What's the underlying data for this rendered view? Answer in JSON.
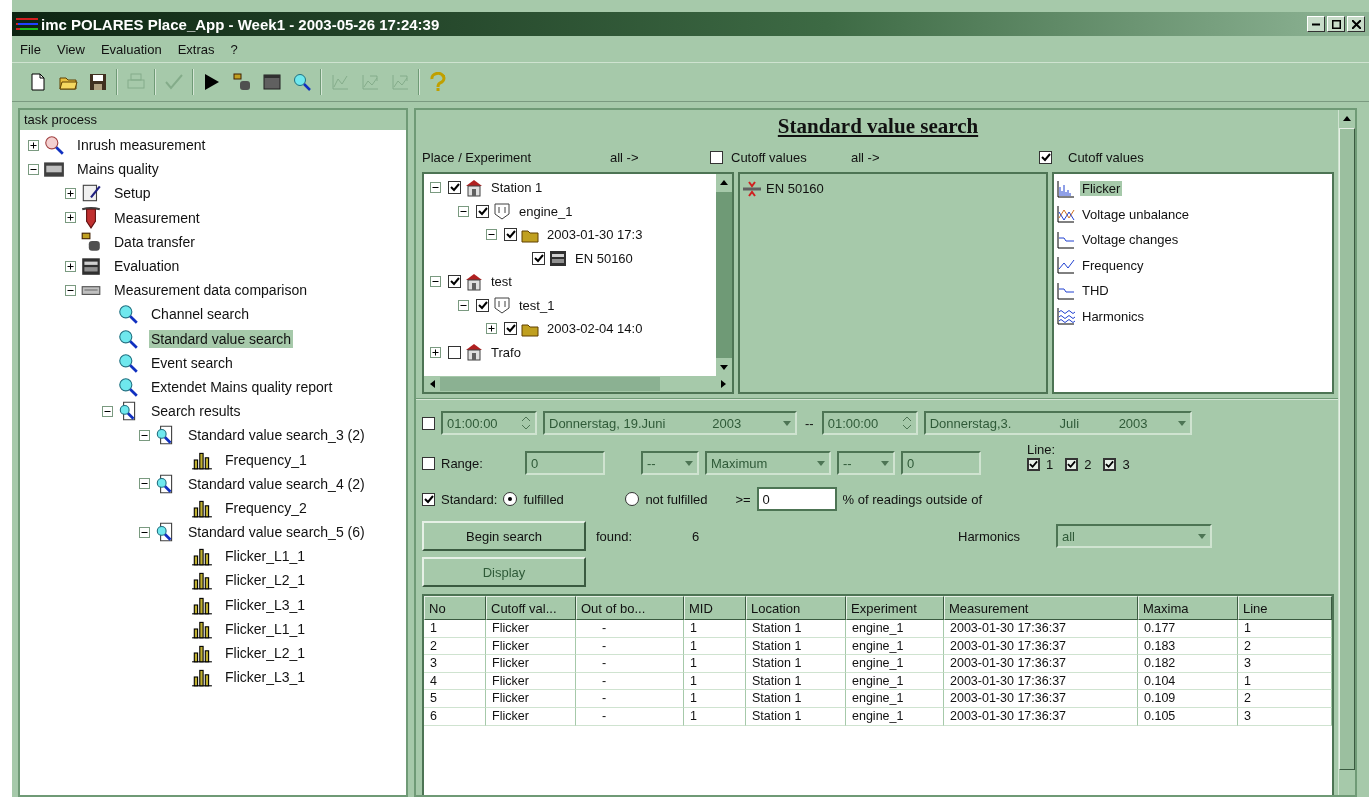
{
  "window": {
    "title": "imc POLARES Place_App - Week1 - 2003-05-26 17:24:39"
  },
  "menu": [
    "File",
    "View",
    "Evaluation",
    "Extras",
    "?"
  ],
  "toolbar": [
    {
      "kind": "new",
      "disabled": false
    },
    {
      "kind": "open",
      "disabled": false
    },
    {
      "kind": "save",
      "disabled": false
    },
    {
      "kind": "sep"
    },
    {
      "kind": "print",
      "disabled": true
    },
    {
      "kind": "sep"
    },
    {
      "kind": "check",
      "disabled": true
    },
    {
      "kind": "sep"
    },
    {
      "kind": "play",
      "disabled": false
    },
    {
      "kind": "transfer",
      "disabled": false
    },
    {
      "kind": "window",
      "disabled": false
    },
    {
      "kind": "search",
      "disabled": false
    },
    {
      "kind": "sep"
    },
    {
      "kind": "chart",
      "disabled": true
    },
    {
      "kind": "chartexport",
      "disabled": true
    },
    {
      "kind": "chartexport",
      "disabled": true
    },
    {
      "kind": "sep"
    },
    {
      "kind": "help",
      "disabled": false
    }
  ],
  "task_panel": {
    "title": "task process",
    "items": [
      {
        "label": "Inrush measurement",
        "kind": "inrush",
        "expanded": false,
        "selected": false
      },
      {
        "label": "Mains quality",
        "kind": "mains",
        "expanded": true,
        "selected": false,
        "children": [
          {
            "label": "Setup",
            "kind": "setup",
            "expanded": false,
            "selected": false
          },
          {
            "label": "Measurement",
            "kind": "probe",
            "expanded": false,
            "selected": false
          },
          {
            "label": "Data transfer",
            "kind": "transfer",
            "selected": false
          },
          {
            "label": "Evaluation",
            "kind": "calc",
            "expanded": false,
            "selected": false
          },
          {
            "label": "Measurement data comparison",
            "kind": "compare",
            "expanded": true,
            "selected": false,
            "children": [
              {
                "label": "Channel search",
                "kind": "search",
                "selected": false
              },
              {
                "label": "Standard value search",
                "kind": "search",
                "selected": true
              },
              {
                "label": "Event search",
                "kind": "search",
                "selected": false
              },
              {
                "label": "Extendet Mains quality report",
                "kind": "search",
                "selected": false
              },
              {
                "label": "Search results",
                "kind": "results",
                "expanded": true,
                "selected": false,
                "children": [
                  {
                    "label": "Standard value search_3 (2)",
                    "kind": "results",
                    "expanded": true,
                    "selected": false,
                    "children": [
                      {
                        "label": "Frequency_1",
                        "kind": "chart",
                        "selected": false
                      }
                    ]
                  },
                  {
                    "label": "Standard value search_4 (2)",
                    "kind": "results",
                    "expanded": true,
                    "selected": false,
                    "children": [
                      {
                        "label": "Frequency_2",
                        "kind": "chart",
                        "selected": false
                      }
                    ]
                  },
                  {
                    "label": "Standard value search_5 (6)",
                    "kind": "results",
                    "expanded": true,
                    "selected": false,
                    "children": [
                      {
                        "label": "Flicker_L1_1",
                        "kind": "chart",
                        "selected": false
                      },
                      {
                        "label": "Flicker_L2_1",
                        "kind": "chart",
                        "selected": false
                      },
                      {
                        "label": "Flicker_L3_1",
                        "kind": "chart",
                        "selected": false
                      },
                      {
                        "label": "Flicker_L1_1",
                        "kind": "chart",
                        "selected": false
                      },
                      {
                        "label": "Flicker_L2_1",
                        "kind": "chart",
                        "selected": false
                      },
                      {
                        "label": "Flicker_L3_1",
                        "kind": "chart",
                        "selected": false
                      }
                    ]
                  }
                ]
              }
            ]
          }
        ]
      }
    ]
  },
  "search": {
    "title": "Standard value search",
    "place_label": "Place / Experiment",
    "place_all": "all ->",
    "cutoff_check": {
      "label": "Cutoff values",
      "checked": false
    },
    "cutoff_all": "all ->",
    "values_check": {
      "label": "Cutoff values",
      "checked": true
    },
    "place_tree": [
      {
        "label": "Station 1",
        "kind": "station",
        "checked": true,
        "expanded": true,
        "children": [
          {
            "label": "engine_1",
            "kind": "experiment",
            "checked": true,
            "expanded": true,
            "children": [
              {
                "label": "2003-01-30 17:3",
                "kind": "folder",
                "checked": true,
                "expanded": true,
                "children": [
                  {
                    "label": "EN 50160",
                    "kind": "calc",
                    "checked": true
                  }
                ]
              }
            ]
          }
        ]
      },
      {
        "label": "test",
        "kind": "station",
        "checked": true,
        "expanded": true,
        "children": [
          {
            "label": "test_1",
            "kind": "experiment",
            "checked": true,
            "expanded": true,
            "children": [
              {
                "label": "2003-02-04 14:0",
                "kind": "folder",
                "checked": true,
                "expanded": false
              }
            ]
          }
        ]
      },
      {
        "label": "Trafo",
        "kind": "station",
        "checked": false,
        "expanded": false
      }
    ],
    "cutoff_list": [
      {
        "label": "EN 50160"
      }
    ],
    "value_list": [
      {
        "label": "Flicker",
        "kind": "flicker",
        "selected": true
      },
      {
        "label": "Voltage unbalance",
        "kind": "unbalance",
        "selected": false
      },
      {
        "label": "Voltage changes",
        "kind": "changes",
        "selected": false
      },
      {
        "label": "Frequency",
        "kind": "frequency",
        "selected": false
      },
      {
        "label": "THD",
        "kind": "changes",
        "selected": false
      },
      {
        "label": "Harmonics",
        "kind": "harmonics",
        "selected": false
      }
    ],
    "time_filter": {
      "checked": false,
      "from_time": "01:00:00",
      "from_date": [
        "Donnerstag, 19.",
        "Juni",
        "2003"
      ],
      "dash": "--",
      "to_time": "01:00:00",
      "to_date": [
        "Donnerstag,",
        "3.",
        "Juli",
        "2003"
      ]
    },
    "range": {
      "label": "Range:",
      "checked": false,
      "value": "0",
      "op1": "--",
      "mode": "Maximum",
      "op2": "--",
      "value2": "0"
    },
    "lines": {
      "label": "Line:",
      "items": [
        {
          "label": "1",
          "checked": true
        },
        {
          "label": "2",
          "checked": true
        },
        {
          "label": "3",
          "checked": true
        }
      ]
    },
    "standard": {
      "label": "Standard:",
      "checked": true,
      "options": [
        {
          "label": "fulfilled",
          "selected": true
        },
        {
          "label": "not fulfilled",
          "selected": false
        }
      ],
      "op": ">=",
      "value": "0",
      "suffix": "% of readings outside of"
    },
    "begin_button": "Begin search",
    "found_label": "found:",
    "found_count": "6",
    "harmonics": {
      "label": "Harmonics",
      "value": "all"
    },
    "display_button": {
      "label": "Display",
      "disabled": true
    },
    "table": {
      "columns": [
        "No",
        "Cutoff val...",
        "Out of bo...",
        "MID",
        "Location",
        "Experiment",
        "Measurement",
        "Maxima",
        "Line"
      ],
      "rows": [
        [
          "1",
          "Flicker",
          "-",
          "1",
          "Station 1",
          "engine_1",
          "2003-01-30 17:36:37",
          "0.177",
          "1"
        ],
        [
          "2",
          "Flicker",
          "-",
          "1",
          "Station 1",
          "engine_1",
          "2003-01-30 17:36:37",
          "0.183",
          "2"
        ],
        [
          "3",
          "Flicker",
          "-",
          "1",
          "Station 1",
          "engine_1",
          "2003-01-30 17:36:37",
          "0.182",
          "3"
        ],
        [
          "4",
          "Flicker",
          "-",
          "1",
          "Station 1",
          "engine_1",
          "2003-01-30 17:36:37",
          "0.104",
          "1"
        ],
        [
          "5",
          "Flicker",
          "-",
          "1",
          "Station 1",
          "engine_1",
          "2003-01-30 17:36:37",
          "0.109",
          "2"
        ],
        [
          "6",
          "Flicker",
          "-",
          "1",
          "Station 1",
          "engine_1",
          "2003-01-30 17:36:37",
          "0.105",
          "3"
        ]
      ]
    }
  }
}
